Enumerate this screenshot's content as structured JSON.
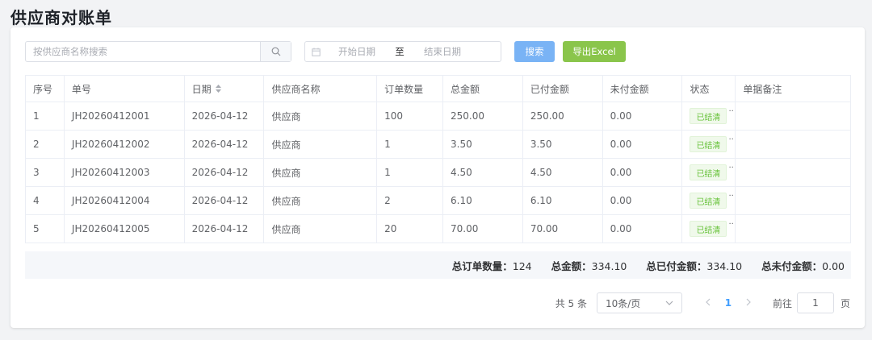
{
  "page": {
    "title": "供应商对账单"
  },
  "toolbar": {
    "search_placeholder": "按供应商名称搜索",
    "search_value": "",
    "date_start_placeholder": "开始日期",
    "date_separator": "至",
    "date_end_placeholder": "结束日期",
    "search_button": "搜索",
    "export_button": "导出Excel"
  },
  "table": {
    "columns": [
      "序号",
      "单号",
      "日期",
      "供应商名称",
      "订单数量",
      "总金额",
      "已付金额",
      "未付金额",
      "状态",
      "单据备注"
    ],
    "rows": [
      {
        "idx": "1",
        "no": "JH20260412001",
        "date": "2026-04-12",
        "supplier": "供应商",
        "qty": "100",
        "total": "250.00",
        "paid": "250.00",
        "unpaid": "0.00",
        "status": "已结清",
        "remark": ""
      },
      {
        "idx": "2",
        "no": "JH20260412002",
        "date": "2026-04-12",
        "supplier": "供应商",
        "qty": "1",
        "total": "3.50",
        "paid": "3.50",
        "unpaid": "0.00",
        "status": "已结清",
        "remark": ""
      },
      {
        "idx": "3",
        "no": "JH20260412003",
        "date": "2026-04-12",
        "supplier": "供应商",
        "qty": "1",
        "total": "4.50",
        "paid": "4.50",
        "unpaid": "0.00",
        "status": "已结清",
        "remark": ""
      },
      {
        "idx": "4",
        "no": "JH20260412004",
        "date": "2026-04-12",
        "supplier": "供应商",
        "qty": "2",
        "total": "6.10",
        "paid": "6.10",
        "unpaid": "0.00",
        "status": "已结清",
        "remark": ""
      },
      {
        "idx": "5",
        "no": "JH20260412005",
        "date": "2026-04-12",
        "supplier": "供应商",
        "qty": "20",
        "total": "70.00",
        "paid": "70.00",
        "unpaid": "0.00",
        "status": "已结清",
        "remark": ""
      }
    ]
  },
  "summary": {
    "order_qty_label": "总订单数量：",
    "order_qty_value": "124",
    "total_label": "总金额：",
    "total_value": "334.10",
    "paid_label": "总已付金额：",
    "paid_value": "334.10",
    "unpaid_label": "总未付金额：",
    "unpaid_value": "0.00"
  },
  "pagination": {
    "total_text": "共 5 条",
    "page_size": "10条/页",
    "current_page": "1",
    "goto_label": "前往",
    "goto_value": "1",
    "page_unit": "页"
  },
  "colors": {
    "primary": "#409eff",
    "search_button": "#79b3f5",
    "export_button": "#8ac54b",
    "status_green": "#67c23a"
  }
}
